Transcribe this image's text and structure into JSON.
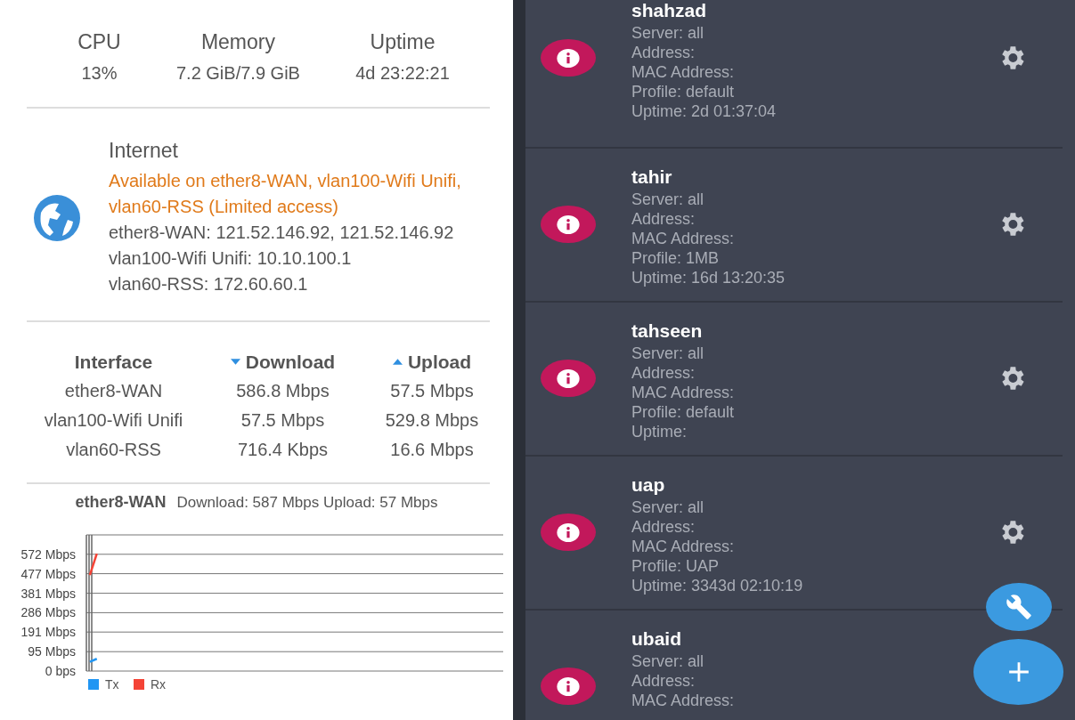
{
  "stats": [
    {
      "label": "CPU",
      "value": "13%"
    },
    {
      "label": "Memory",
      "value": "7.2 GiB/7.9 GiB"
    },
    {
      "label": "Uptime",
      "value": "4d 23:22:21"
    }
  ],
  "internet": {
    "title": "Internet",
    "status": "Available on ether8-WAN, vlan100-Wifi Unifi, vlan60-RSS (Limited access)",
    "addresses": [
      "ether8-WAN: 121.52.146.92, 121.52.146.92",
      "vlan100-Wifi Unifi: 10.10.100.1",
      "vlan60-RSS: 172.60.60.1"
    ]
  },
  "traffic": {
    "columns": [
      {
        "label": "Interface",
        "kind": "plain"
      },
      {
        "label": "Download",
        "kind": "down"
      },
      {
        "label": "Upload",
        "kind": "up"
      }
    ],
    "rows": [
      [
        "ether8-WAN",
        "586.8 Mbps",
        "57.5 Mbps"
      ],
      [
        "vlan100-Wifi Unifi",
        "57.5 Mbps",
        "529.8 Mbps"
      ],
      [
        "vlan60-RSS",
        "716.4 Kbps",
        "16.6 Mbps"
      ]
    ]
  },
  "graph": {
    "interface": "ether8-WAN",
    "summary": "Download: 587 Mbps Upload: 57 Mbps",
    "chart_data": {
      "type": "line",
      "categories": [
        null,
        null,
        null,
        null,
        null,
        null,
        null,
        null,
        null,
        null,
        null,
        null,
        null,
        null,
        null,
        null,
        null,
        null,
        null,
        null,
        null,
        null,
        null,
        null,
        null,
        null,
        null,
        null,
        null,
        null,
        null,
        null,
        null,
        null,
        null,
        null,
        null,
        null,
        null,
        null,
        null,
        null,
        null,
        null,
        null,
        null,
        null,
        null,
        null,
        null,
        null,
        null,
        null,
        null,
        null,
        null,
        null,
        null,
        null,
        null
      ],
      "grid": true,
      "legend": true,
      "ylim": [
        0,
        667
      ],
      "yticks": [
        {
          "value": 0,
          "label": "0 bps"
        },
        {
          "value": 95,
          "label": "95 Mbps"
        },
        {
          "value": 191,
          "label": "191 Mbps"
        },
        {
          "value": 286,
          "label": "286 Mbps"
        },
        {
          "value": 381,
          "label": "381 Mbps"
        },
        {
          "value": 477,
          "label": "477 Mbps"
        },
        {
          "value": 572,
          "label": "572 Mbps"
        }
      ],
      "series": [
        {
          "name": "Tx",
          "color": "#2196f3",
          "values": [
            45,
            60,
            null,
            null,
            null,
            null,
            null,
            null,
            null,
            null,
            null,
            null,
            null,
            null,
            null,
            null,
            null,
            null,
            null,
            null,
            null,
            null,
            null,
            null,
            null,
            null,
            null,
            null,
            null,
            null,
            null,
            null,
            null,
            null,
            null,
            null,
            null,
            null,
            null,
            null,
            null,
            null,
            null,
            null,
            null,
            null,
            null,
            null,
            null,
            null,
            null,
            null,
            null,
            null,
            null,
            null,
            null,
            null,
            null,
            null
          ]
        },
        {
          "name": "Rx",
          "color": "#f44336",
          "values": [
            470,
            575,
            null,
            null,
            null,
            null,
            null,
            null,
            null,
            null,
            null,
            null,
            null,
            null,
            null,
            null,
            null,
            null,
            null,
            null,
            null,
            null,
            null,
            null,
            null,
            null,
            null,
            null,
            null,
            null,
            null,
            null,
            null,
            null,
            null,
            null,
            null,
            null,
            null,
            null,
            null,
            null,
            null,
            null,
            null,
            null,
            null,
            null,
            null,
            null,
            null,
            null,
            null,
            null,
            null,
            null,
            null,
            null,
            null,
            null
          ]
        }
      ]
    }
  },
  "users": [
    {
      "name": "shahzad",
      "details": [
        "Server: all",
        "Address:",
        "MAC Address:",
        "Profile: default",
        "Uptime: 2d 01:37:04"
      ]
    },
    {
      "name": "tahir",
      "details": [
        "Server: all",
        "Address:",
        "MAC Address:",
        "Profile: 1MB",
        "Uptime: 16d 13:20:35"
      ]
    },
    {
      "name": "tahseen",
      "details": [
        "Server: all",
        "Address:",
        "MAC Address:",
        "Profile: default",
        "Uptime:"
      ]
    },
    {
      "name": "uap",
      "details": [
        "Server: all",
        "Address:",
        "MAC Address:",
        "Profile: UAP",
        "Uptime: 3343d 02:10:19"
      ]
    },
    {
      "name": "ubaid",
      "details": [
        "Server: all",
        "Address:",
        "MAC Address:"
      ]
    }
  ]
}
